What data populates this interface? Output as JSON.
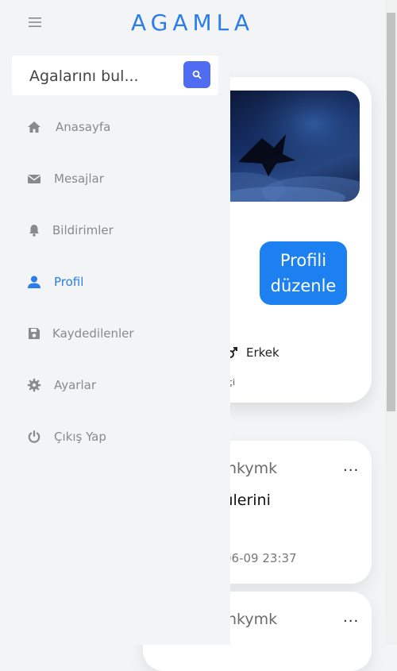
{
  "app": {
    "brand": "AGAMLA"
  },
  "colors": {
    "accent": "#2b7de9",
    "button": "#1d80f0",
    "search_button": "#4f6cf2",
    "inactive": "#8a8a8a"
  },
  "search": {
    "placeholder": "Agalarını bul..."
  },
  "menu": {
    "items": [
      {
        "label": "Anasayfa",
        "icon": "home-icon",
        "active": false
      },
      {
        "label": "Mesajlar",
        "icon": "envelope-icon",
        "active": false
      },
      {
        "label": "Bildirimler",
        "icon": "bell-icon",
        "active": false
      },
      {
        "label": "Profil",
        "icon": "user-icon",
        "active": true
      },
      {
        "label": "Kaydedilenler",
        "icon": "save-icon",
        "active": false
      },
      {
        "label": "Ayarlar",
        "icon": "gear-icon",
        "active": false
      },
      {
        "label": "Çıkış Yap",
        "icon": "power-icon",
        "active": false
      }
    ]
  },
  "profile": {
    "edit_button": "Profili düzenle",
    "gender": "Erkek",
    "subline": "çi"
  },
  "posts": [
    {
      "user": "nkymk",
      "text": "tülerini",
      "time": "06-09 23:37",
      "more": "..."
    },
    {
      "user": "nkymk",
      "more": "..."
    }
  ]
}
